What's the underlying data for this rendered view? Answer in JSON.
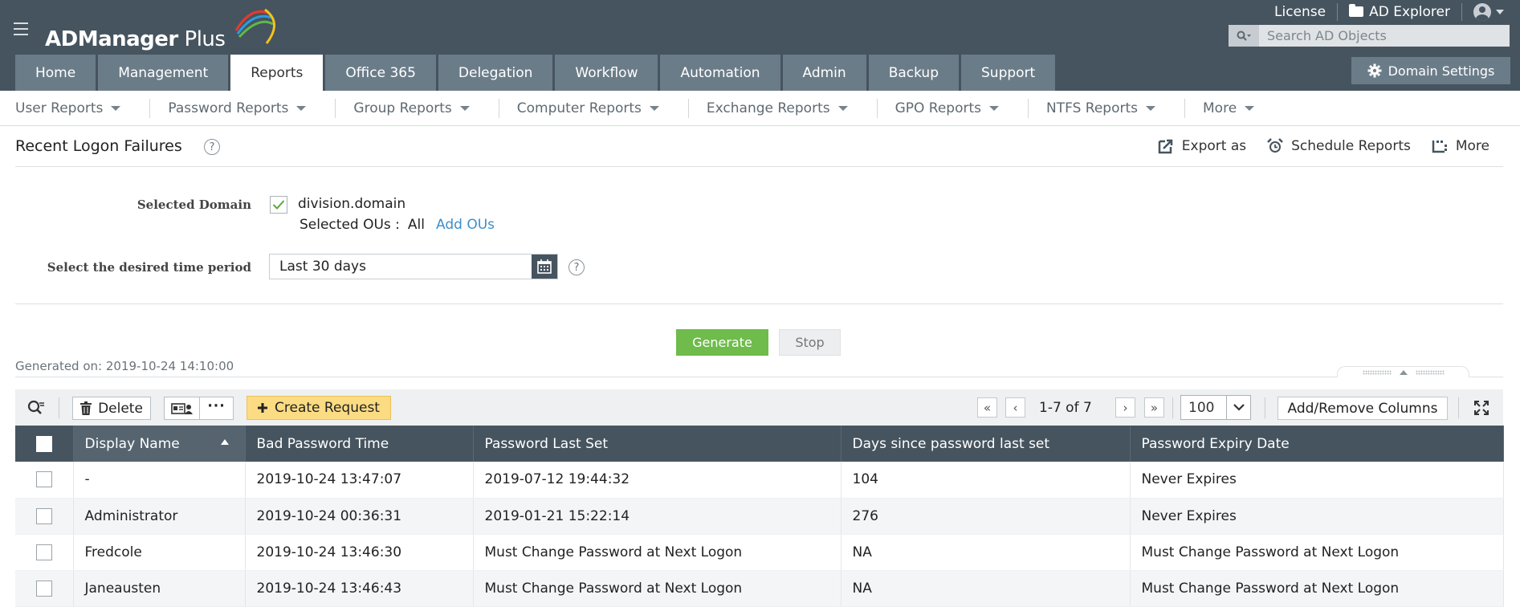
{
  "app": {
    "name_main": "ADManager",
    "name_sub": " Plus"
  },
  "top_links": {
    "license": "License",
    "ad_explorer": "AD Explorer"
  },
  "search": {
    "placeholder": "Search AD Objects"
  },
  "nav_tabs": [
    "Home",
    "Management",
    "Reports",
    "Office 365",
    "Delegation",
    "Workflow",
    "Automation",
    "Admin",
    "Backup",
    "Support"
  ],
  "active_tab": "Reports",
  "domain_settings": "Domain Settings",
  "sub_nav": [
    "User Reports",
    "Password Reports",
    "Group Reports",
    "Computer Reports",
    "Exchange Reports",
    "GPO Reports",
    "NTFS Reports",
    "More"
  ],
  "page": {
    "title": "Recent Logon Failures",
    "help": "?",
    "actions": {
      "export": "Export as",
      "schedule": "Schedule Reports",
      "more": "More"
    }
  },
  "form": {
    "domain_label": "Selected Domain",
    "domain_value": "division.domain",
    "domain_checked": true,
    "ous_label": "Selected OUs :",
    "ous_value": "All",
    "add_ous": "Add OUs",
    "period_label": "Select the desired time period",
    "period_value": "Last 30 days"
  },
  "buttons": {
    "generate": "Generate",
    "stop": "Stop"
  },
  "generated_on": "Generated on: 2019-10-24 14:10:00",
  "toolbar": {
    "delete": "Delete",
    "create_request": "Create Request",
    "pagination": "1-7 of 7",
    "per_page": "100",
    "add_remove_columns": "Add/Remove Columns"
  },
  "colors": {
    "header_bg": "#46545f",
    "tab_bg": "#6b7c89",
    "generate": "#6fbb4b",
    "create_request": "#fbdc83",
    "link": "#3d8fcb"
  },
  "table": {
    "columns": [
      "Display Name",
      "Bad Password Time",
      "Password Last Set",
      "Days since password last set",
      "Password Expiry Date"
    ],
    "sorted_column": "Display Name",
    "rows": [
      [
        "-",
        "2019-10-24 13:47:07",
        "2019-07-12 19:44:32",
        "104",
        "Never Expires"
      ],
      [
        "Administrator",
        "2019-10-24 00:36:31",
        "2019-01-21 15:22:14",
        "276",
        "Never Expires"
      ],
      [
        "Fredcole",
        "2019-10-24 13:46:30",
        "Must Change Password at Next Logon",
        "NA",
        "Must Change Password at Next Logon"
      ],
      [
        "Janeausten",
        "2019-10-24 13:46:43",
        "Must Change Password at Next Logon",
        "NA",
        "Must Change Password at Next Logon"
      ]
    ]
  }
}
